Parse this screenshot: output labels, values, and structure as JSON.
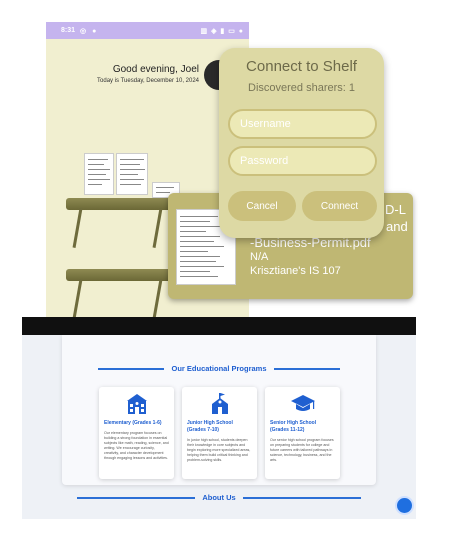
{
  "phone": {
    "status_bar": {
      "time": "8:31",
      "left_icons": "◎ ●",
      "right_icons": "▥ ◈ ▮ ▭ ●"
    },
    "greeting": "Good evening, Joel",
    "date_line": "Today is Tuesday, December 10, 2024"
  },
  "dialog": {
    "title": "Connect to Shelf",
    "subtitle": "Discovered sharers: 1",
    "username_placeholder": "Username",
    "password_placeholder": "Password",
    "cancel_label": "Cancel",
    "connect_label": "Connect"
  },
  "doc_card": {
    "title_line1": "D-L",
    "title_line2": "and",
    "title_line3": "-Business-Permit.pdf",
    "subtitle": "N/A",
    "owner": "Krisztiane's IS 107"
  },
  "website": {
    "programs_heading": "Our Educational Programs",
    "programs": [
      {
        "icon": "school-building-icon",
        "title": "Elementary (Grades 1-6)",
        "description": "Our elementary program focuses on building a strong foundation in essential subjects like math, reading, science, and writing. We encourage curiosity, creativity, and character development through engaging lessons and activities."
      },
      {
        "icon": "school-house-icon",
        "title": "Junior High School (Grades 7-10)",
        "description": "In junior high school, students deepen their knowledge in core subjects and begin exploring more specialized areas, helping them build critical thinking and problem-solving skills."
      },
      {
        "icon": "graduation-cap-icon",
        "title": "Senior High School (Grades 11-12)",
        "description": "Our senior high school program focuses on preparing students for college and future careers with tailored pathways in science, technology, business, and the arts."
      }
    ],
    "about_heading": "About Us"
  },
  "colors": {
    "phone_bg": "#f1efd0",
    "status_bar": "#c5b4ee",
    "dialog_bg": "#ddd9a4",
    "dialog_accent": "#cbc07c",
    "card_bg": "#bfb773",
    "site_accent": "#1f5fd0"
  }
}
